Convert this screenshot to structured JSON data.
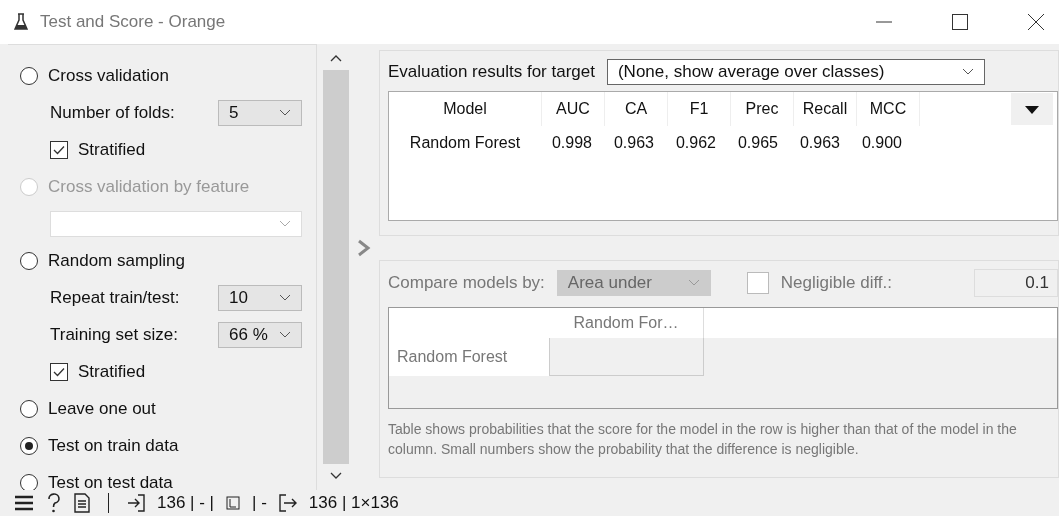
{
  "window": {
    "title": "Test and Score - Orange"
  },
  "sampling": [
    {
      "kind": "radio",
      "label": "Cross validation",
      "selected": false,
      "disabled": false
    },
    {
      "kind": "dropdown",
      "label": "Number of folds:",
      "value": "5",
      "disabled": false
    },
    {
      "kind": "checkbox",
      "label": "Stratified",
      "checked": true
    },
    {
      "kind": "radio",
      "label": "Cross validation by feature",
      "selected": false,
      "disabled": true
    },
    {
      "kind": "dropdown",
      "disabled": false
    },
    {
      "kind": "radio",
      "label": "Random sampling",
      "selected": false,
      "disabled": false
    },
    {
      "kind": "dropdown",
      "label": "Repeat train/test:",
      "value": "10",
      "disabled": false
    },
    {
      "kind": "dropdown",
      "label": "Training set size:",
      "value": "66 %",
      "disabled": false
    },
    {
      "kind": "checkbox",
      "label": "Stratified",
      "checked": true
    },
    {
      "kind": "radio",
      "label": "Leave one out",
      "selected": false,
      "disabled": false
    },
    {
      "kind": "radio",
      "label": "Test on train data",
      "selected": true,
      "disabled": false
    },
    {
      "kind": "radio",
      "label": "Test on test data",
      "selected": false,
      "disabled": false
    }
  ],
  "evaluation": {
    "label": "Evaluation results for target",
    "target": "(None, show average over classes)",
    "columns": [
      "Model",
      "AUC",
      "CA",
      "F1",
      "Prec",
      "Recall",
      "MCC"
    ],
    "rows": [
      [
        "Random Forest",
        "0.998",
        "0.963",
        "0.962",
        "0.965",
        "0.963",
        "0.900"
      ]
    ]
  },
  "comparison": {
    "disabled": true,
    "label": "Compare models by:",
    "metric": "Area under",
    "negligible": {
      "label": "Negligible diff.:",
      "checked": false,
      "value": "0.1"
    },
    "columns": [
      "Random For…"
    ],
    "rows": [
      "Random Forest"
    ],
    "note": "Table shows probabilities that the score for the model in the row is higher than that of the model in the column. Small numbers show the probability that the difference is negligible."
  },
  "status_bar": {
    "input": "136 | - |",
    "input_extra": "| -",
    "output": "136 | 1×136"
  }
}
